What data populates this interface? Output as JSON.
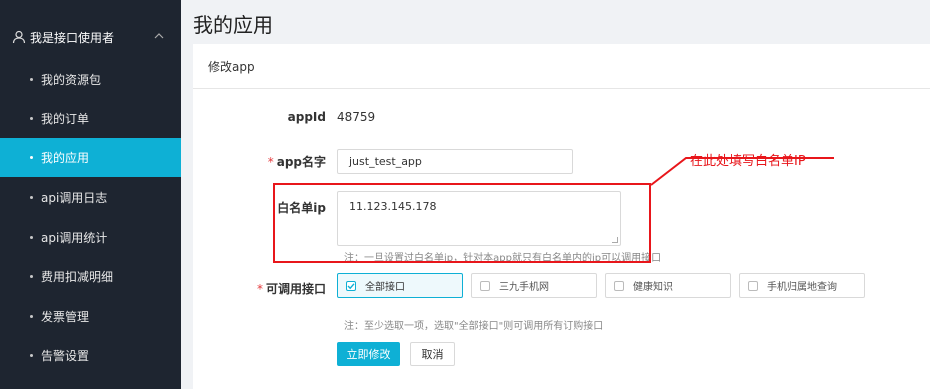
{
  "sidebar": {
    "group_label": "我是接口使用者",
    "items": [
      {
        "label": "我的资源包",
        "active": false
      },
      {
        "label": "我的订单",
        "active": false
      },
      {
        "label": "我的应用",
        "active": true
      },
      {
        "label": "api调用日志",
        "active": false
      },
      {
        "label": "api调用统计",
        "active": false
      },
      {
        "label": "费用扣减明细",
        "active": false
      },
      {
        "label": "发票管理",
        "active": false
      },
      {
        "label": "告警设置",
        "active": false
      }
    ]
  },
  "page": {
    "title": "我的应用",
    "card_title": "修改app"
  },
  "form": {
    "appid_label": "appId",
    "appid_value": "48759",
    "appname_label": "app名字",
    "appname_value": "just_test_app",
    "whitelist_label": "白名单ip",
    "whitelist_value": "11.123.145.178",
    "whitelist_hint": "注：一旦设置过白名单ip，针对本app就只有白名单内的ip可以调用接口",
    "interfaces_label": "可调用接口",
    "interfaces": [
      {
        "label": "全部接口",
        "checked": true
      },
      {
        "label": "三九手机网",
        "checked": false
      },
      {
        "label": "健康知识",
        "checked": false
      },
      {
        "label": "手机归属地查询",
        "checked": false
      }
    ],
    "interfaces_hint": "注：至少选取一项，选取\"全部接口\"则可调用所有订购接口",
    "submit_label": "立即修改",
    "cancel_label": "取消"
  },
  "annotation": {
    "text": "在此处填写白名单IP",
    "color": "#e8161b"
  },
  "colors": {
    "accent": "#0eb0d5",
    "sidebar_bg": "#1e2530"
  }
}
